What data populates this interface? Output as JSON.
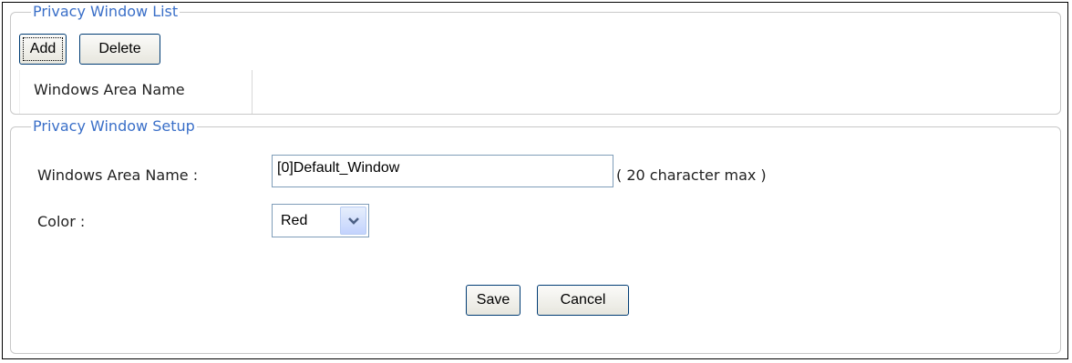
{
  "list_section": {
    "legend": "Privacy Window List",
    "add_label": "Add",
    "delete_label": "Delete",
    "column_header": "Windows Area Name"
  },
  "setup_section": {
    "legend": "Privacy Window Setup",
    "name_label": "Windows Area Name :",
    "name_value": "[0]Default_Window",
    "name_hint": "( 20 character max )",
    "color_label": "Color :",
    "color_selected": "Red",
    "save_label": "Save",
    "cancel_label": "Cancel"
  },
  "icons": {
    "dropdown": "chevron-down-icon"
  },
  "colors": {
    "legend_text": "#3a6fc8",
    "button_border": "#003c74",
    "input_border": "#7f9db9"
  }
}
